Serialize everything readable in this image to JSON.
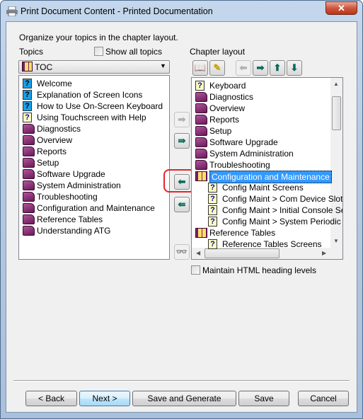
{
  "window": {
    "title": "Print Document Content - Printed Documentation",
    "close_label": "✕"
  },
  "instructions": "Organize your topics in the chapter layout.",
  "topics": {
    "label": "Topics",
    "show_all": {
      "label": "Show all topics",
      "checked": false
    },
    "combo_value": "TOC",
    "items": [
      {
        "label": "Welcome",
        "icon": "topic-blue"
      },
      {
        "label": "Explanation of Screen Icons",
        "icon": "topic-blue"
      },
      {
        "label": "How to Use On-Screen Keyboard",
        "icon": "topic-blue"
      },
      {
        "label": "Using Touchscreen with Help",
        "icon": "topic"
      },
      {
        "label": "Diagnostics",
        "icon": "book"
      },
      {
        "label": "Overview",
        "icon": "book"
      },
      {
        "label": "Reports",
        "icon": "book"
      },
      {
        "label": "Setup",
        "icon": "book"
      },
      {
        "label": "Software Upgrade",
        "icon": "book"
      },
      {
        "label": "System Administration",
        "icon": "book"
      },
      {
        "label": "Troubleshooting",
        "icon": "book"
      },
      {
        "label": "Configuration and Maintenance",
        "icon": "book"
      },
      {
        "label": "Reference Tables",
        "icon": "book"
      },
      {
        "label": "Understanding ATG",
        "icon": "book"
      }
    ]
  },
  "middle_buttons": [
    {
      "name": "add-button",
      "icon": "arrow-right",
      "disabled": true,
      "glyph": "➡"
    },
    {
      "name": "add-all-button",
      "icon": "double-arrow-right",
      "disabled": false,
      "glyph": "⇛"
    },
    {
      "name": "remove-button",
      "icon": "arrow-left",
      "disabled": false,
      "glyph": "⬅"
    },
    {
      "name": "remove-all-button",
      "icon": "double-arrow-left",
      "disabled": false,
      "glyph": "⇚"
    },
    {
      "name": "preview-button",
      "icon": "glasses",
      "disabled": true,
      "glyph": "👓"
    }
  ],
  "chapter": {
    "label": "Chapter layout",
    "toolbar": [
      {
        "name": "new-chapter-button",
        "icon": "new-book",
        "glyph": "📖"
      },
      {
        "name": "rename-button",
        "icon": "pencil",
        "glyph": "✎"
      },
      {
        "name": "move-left-button",
        "icon": "arrow-left",
        "disabled": true,
        "glyph": "⬅"
      },
      {
        "name": "move-right-button",
        "icon": "arrow-right",
        "glyph": "➡"
      },
      {
        "name": "move-up-button",
        "icon": "arrow-up",
        "glyph": "⬆"
      },
      {
        "name": "move-down-button",
        "icon": "arrow-down",
        "glyph": "⬇"
      }
    ],
    "items": [
      {
        "label": "Keyboard",
        "icon": "topic",
        "indent": 0
      },
      {
        "label": "Diagnostics",
        "icon": "book",
        "indent": 0
      },
      {
        "label": "Overview",
        "icon": "book",
        "indent": 0
      },
      {
        "label": "Reports",
        "icon": "book",
        "indent": 0
      },
      {
        "label": "Setup",
        "icon": "book",
        "indent": 0
      },
      {
        "label": "Software Upgrade",
        "icon": "book",
        "indent": 0
      },
      {
        "label": "System Administration",
        "icon": "book",
        "indent": 0
      },
      {
        "label": "Troubleshooting",
        "icon": "book",
        "indent": 0
      },
      {
        "label": "Configuration and Maintenance",
        "icon": "open-book",
        "indent": 0,
        "selected": true
      },
      {
        "label": "Config Maint Screens",
        "icon": "topic",
        "indent": 1
      },
      {
        "label": "Config Maint > Com Device Slots",
        "icon": "topic",
        "indent": 1
      },
      {
        "label": "Config Maint > Initial Console Se",
        "icon": "topic",
        "indent": 1
      },
      {
        "label": "Config Maint > System Periodic I",
        "icon": "topic",
        "indent": 1
      },
      {
        "label": "Reference Tables",
        "icon": "open-book",
        "indent": 0
      },
      {
        "label": "Reference Tables Screens",
        "icon": "topic",
        "indent": 1
      }
    ],
    "maintain_html": {
      "label": "Maintain HTML heading levels",
      "checked": false
    }
  },
  "footer": {
    "back": "< Back",
    "next": "Next >",
    "save_generate": "Save and Generate",
    "save": "Save",
    "cancel": "Cancel"
  },
  "colors": {
    "selection": "#3399ff",
    "highlight_ring": "#e0262b"
  }
}
